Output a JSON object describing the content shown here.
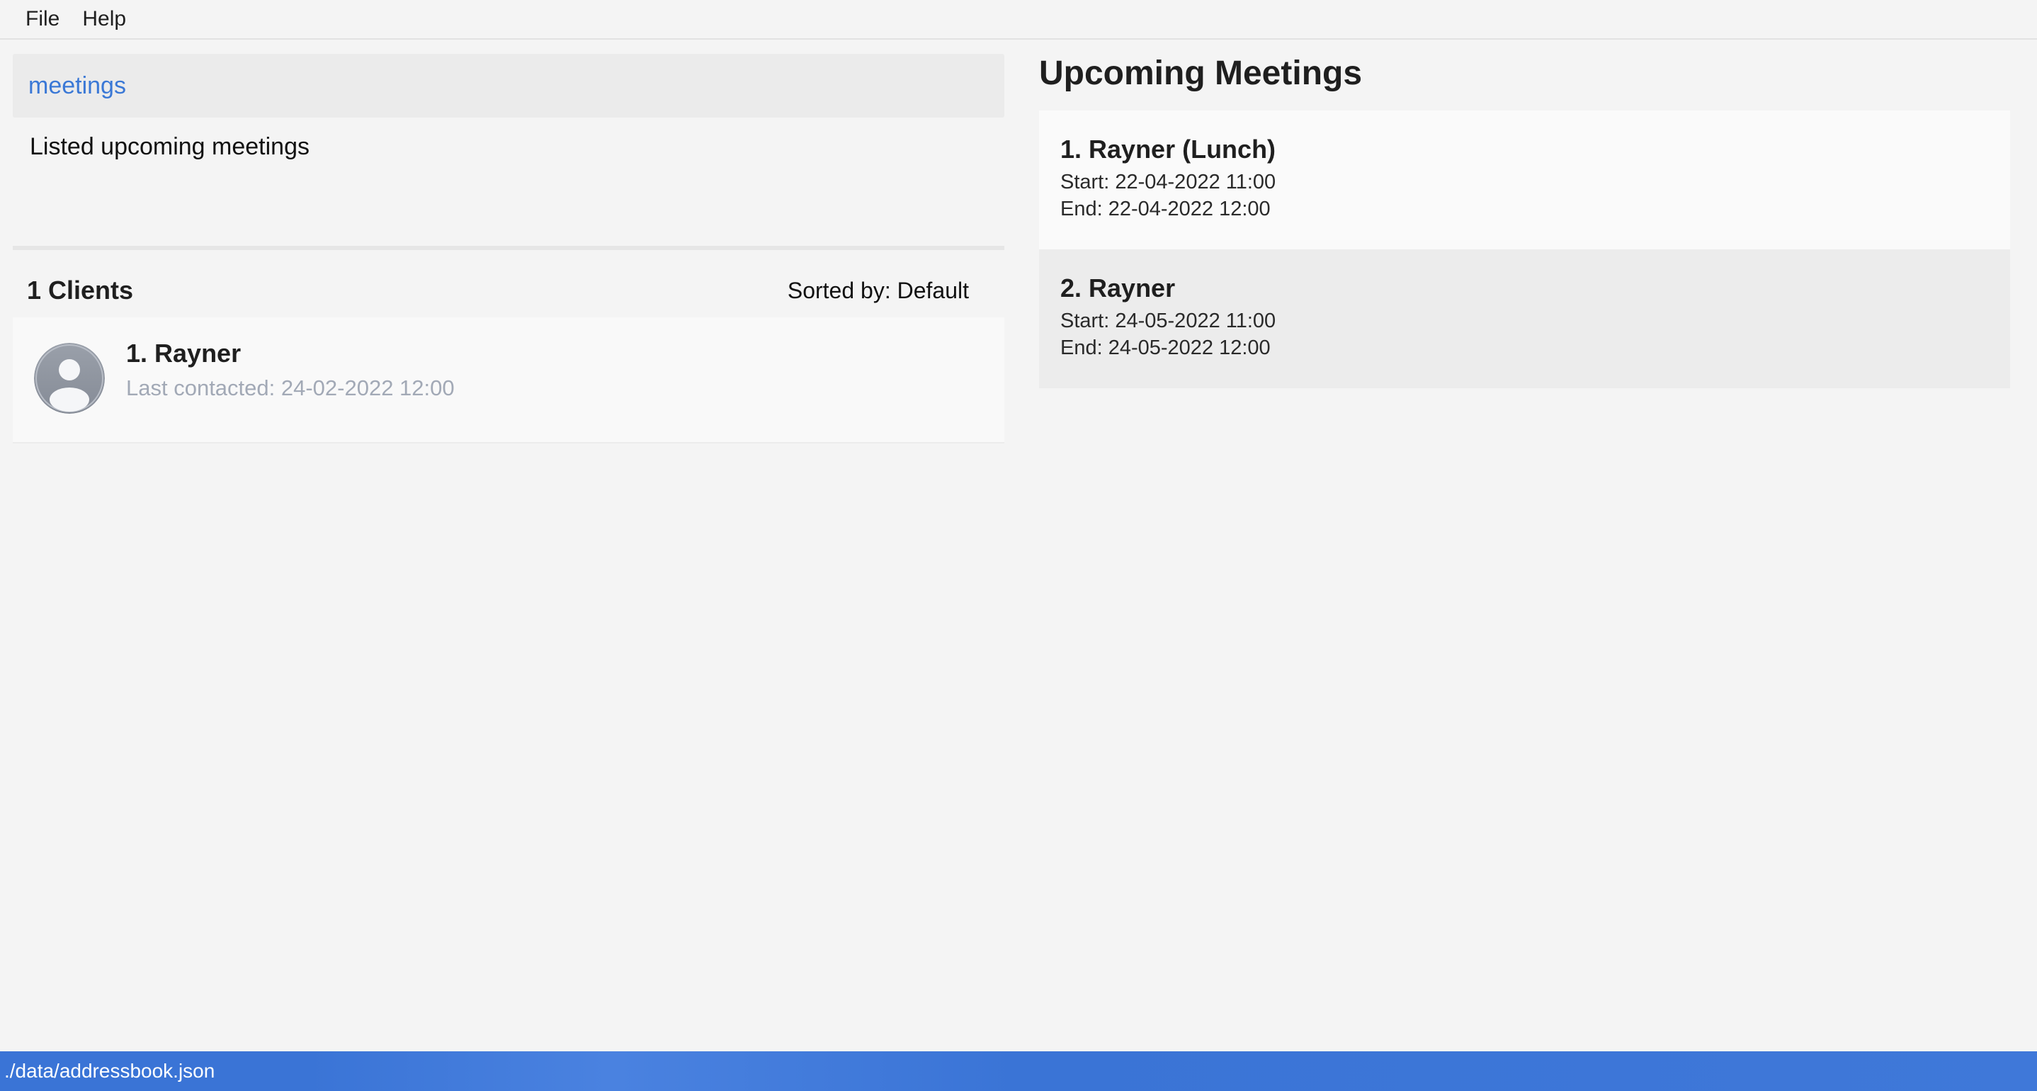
{
  "menu": {
    "file": "File",
    "help": "Help"
  },
  "command": {
    "text": "meetings"
  },
  "result": {
    "text": "Listed upcoming meetings"
  },
  "clients": {
    "count_label": "1 Clients",
    "sorted_label": "Sorted by: Default",
    "items": [
      {
        "name": "1.  Rayner",
        "last_contacted": "Last contacted: 24-02-2022 12:00"
      }
    ]
  },
  "meetings": {
    "title": "Upcoming Meetings",
    "items": [
      {
        "name": "1.  Rayner (Lunch)",
        "start": "Start: 22-04-2022 11:00",
        "end": "End: 22-04-2022 12:00"
      },
      {
        "name": "2.  Rayner",
        "start": "Start: 24-05-2022 11:00",
        "end": "End: 24-05-2022 12:00"
      }
    ]
  },
  "status": {
    "path": "./data/addressbook.json"
  },
  "colors": {
    "accent": "#3a78d6",
    "status_bar": "#3a74d6",
    "muted_text": "#a2a9b6"
  },
  "icons": {
    "avatar": "person-avatar-icon"
  }
}
